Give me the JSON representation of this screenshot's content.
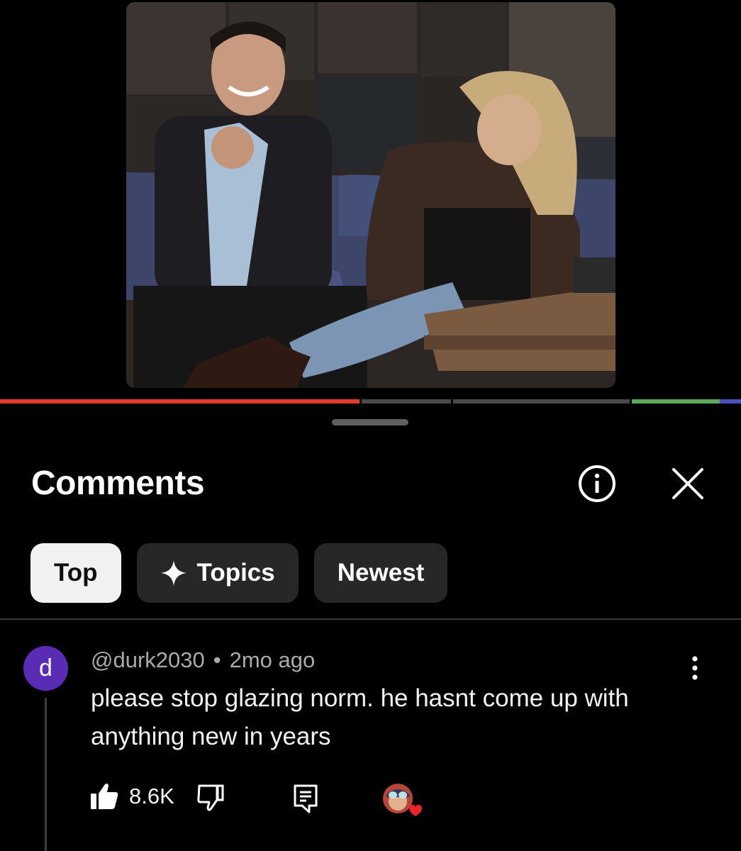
{
  "video": {
    "thumbnail_icon": "video-frame-talk-show",
    "progress": {
      "played_fraction": 0.485,
      "colors": {
        "played": "#e43b2f",
        "buffered": "#4a4a4a",
        "chapter_green": "#5da85a",
        "chapter_blue": "#4b4fb8"
      }
    }
  },
  "comments_panel": {
    "title": "Comments",
    "info_icon": "info-circle-icon",
    "close_icon": "close-icon",
    "chips": [
      {
        "label": "Top",
        "active": true
      },
      {
        "label": "Topics",
        "icon": "sparkle-icon",
        "active": false
      },
      {
        "label": "Newest",
        "active": false
      }
    ]
  },
  "comment": {
    "avatar_letter": "d",
    "avatar_color": "#5a2bb5",
    "author": "@durk2030",
    "separator": "•",
    "time": "2mo ago",
    "text": "please stop glazing norm. he hasnt come up with anything new in years",
    "likes": "8.6K",
    "actions": {
      "like_icon": "thumbs-up-icon",
      "dislike_icon": "thumbs-down-icon",
      "reply_icon": "reply-icon",
      "creator_heart_icon": "creator-heart-icon",
      "more_icon": "more-vert-icon"
    }
  }
}
